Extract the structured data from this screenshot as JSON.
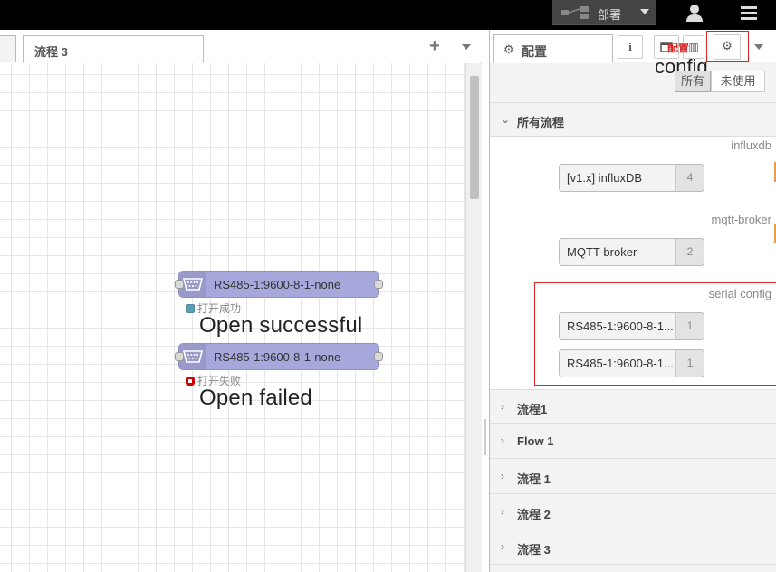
{
  "header": {
    "deploy_label": "部署"
  },
  "workspace": {
    "active_tab": "流程 3",
    "nodes": [
      {
        "label": "RS485-1:9600-8-1-none",
        "status": "打开成功",
        "annotation": "Open successful",
        "status_type": "ok"
      },
      {
        "label": "RS485-1:9600-8-1-none",
        "status": "打开失败",
        "annotation": "Open failed",
        "status_type": "fail"
      }
    ]
  },
  "sidebar": {
    "tab_label": "配置",
    "overlay_red_text": "配置",
    "overlay_annotation": "config",
    "filters": {
      "all": "所有",
      "unused": "未使用"
    },
    "all_flows_label": "所有流程",
    "categories": [
      {
        "name": "influxdb",
        "nodes": [
          {
            "label": "[v1.x] influxDB",
            "count": "4"
          }
        ]
      },
      {
        "name": "mqtt-broker",
        "nodes": [
          {
            "label": "MQTT-broker",
            "count": "2"
          }
        ]
      },
      {
        "name": "serial config",
        "nodes": [
          {
            "label": "RS485-1:9600-8-1...",
            "count": "1"
          },
          {
            "label": "RS485-1:9600-8-1...",
            "count": "1"
          }
        ]
      }
    ],
    "flows": [
      "流程1",
      "Flow 1",
      "流程 1",
      "流程 2",
      "流程 3"
    ]
  },
  "colors": {
    "node_fill": "#a6a8dc",
    "status_ok": "#5d9db3",
    "status_fail": "#cc0000",
    "highlight": "#dd2222"
  }
}
